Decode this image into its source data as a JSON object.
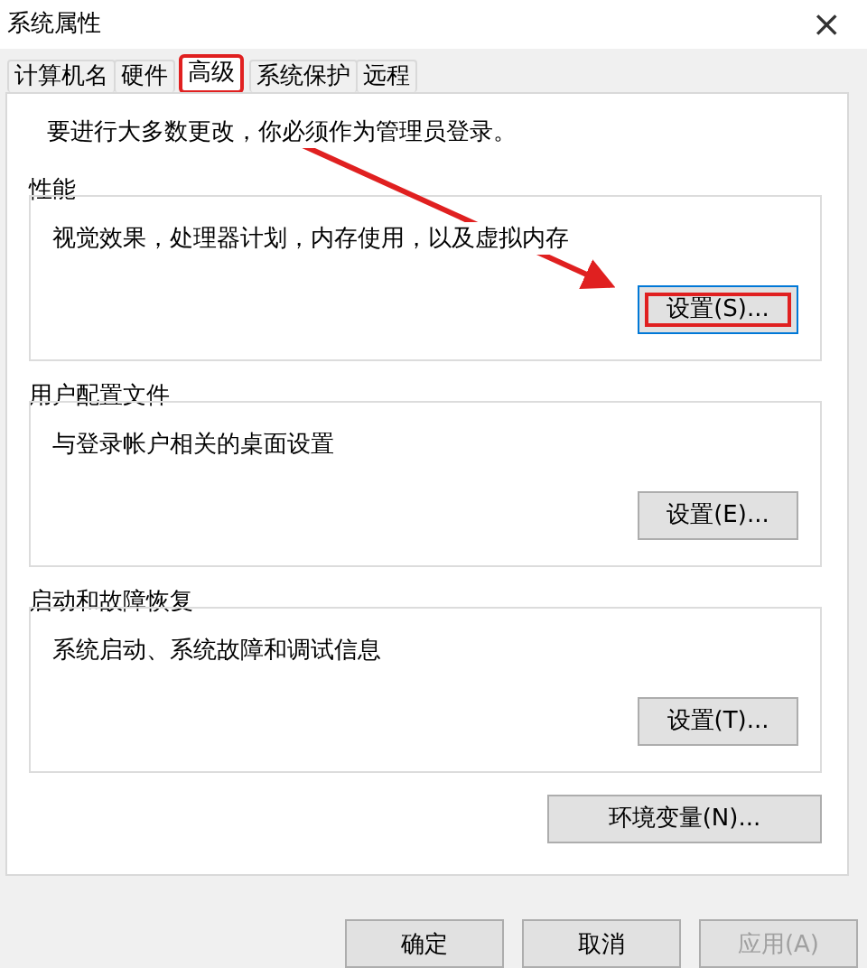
{
  "window": {
    "title": "系统属性",
    "close": "×"
  },
  "tabs": [
    {
      "label": "计算机名",
      "selected": false,
      "highlighted": false
    },
    {
      "label": "硬件",
      "selected": false,
      "highlighted": false
    },
    {
      "label": "高级",
      "selected": true,
      "highlighted": true
    },
    {
      "label": "系统保护",
      "selected": false,
      "highlighted": false
    },
    {
      "label": "远程",
      "selected": false,
      "highlighted": false
    }
  ],
  "notice": "要进行大多数更改，你必须作为管理员登录。",
  "groups": [
    {
      "title": "性能",
      "description": "视觉效果，处理器计划，内存使用，以及虚拟内存",
      "button": {
        "label": "设置(S)...",
        "highlighted": true,
        "focused": true
      }
    },
    {
      "title": "用户配置文件",
      "description": "与登录帐户相关的桌面设置",
      "button": {
        "label": "设置(E)...",
        "highlighted": false,
        "focused": false
      }
    },
    {
      "title": "启动和故障恢复",
      "description": "系统启动、系统故障和调试信息",
      "button": {
        "label": "设置(T)...",
        "highlighted": false,
        "focused": false
      }
    }
  ],
  "env_button": "环境变量(N)...",
  "footer": [
    {
      "label": "确定",
      "disabled": false
    },
    {
      "label": "取消",
      "disabled": false
    },
    {
      "label": "应用(A)",
      "disabled": true
    }
  ]
}
